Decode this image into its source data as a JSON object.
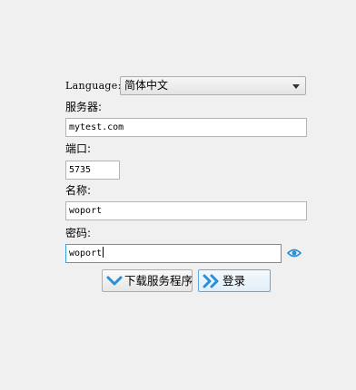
{
  "language": {
    "label": "Language:",
    "selected": "简体中文"
  },
  "server": {
    "label": "服务器:",
    "value": "mytest.com"
  },
  "port": {
    "label": "端口:",
    "value": "5735"
  },
  "name": {
    "label": "名称:",
    "value": "woport"
  },
  "password": {
    "label": "密码:",
    "value": "woport"
  },
  "buttons": {
    "download": "下载服务程序",
    "login": "登录"
  },
  "colors": {
    "accent": "#2a8fd6",
    "focus_border": "#3aa0e0",
    "background": "#f0f0f0"
  },
  "icons": {
    "dropdown": "chevron-down-icon",
    "show_password": "eye-icon",
    "download": "chevron-down-icon",
    "login": "double-chevron-right-icon"
  }
}
